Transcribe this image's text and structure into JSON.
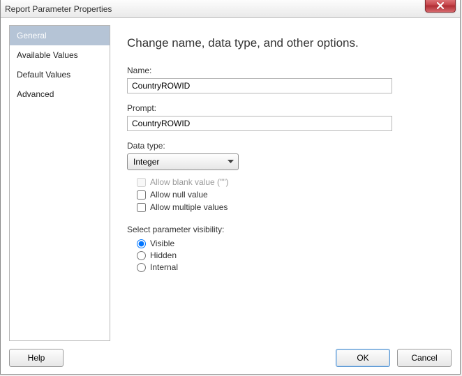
{
  "window": {
    "title": "Report Parameter Properties"
  },
  "sidebar": {
    "items": [
      {
        "label": "General",
        "selected": true
      },
      {
        "label": "Available Values",
        "selected": false
      },
      {
        "label": "Default Values",
        "selected": false
      },
      {
        "label": "Advanced",
        "selected": false
      }
    ]
  },
  "pane": {
    "heading": "Change name, data type, and other options.",
    "name_label": "Name:",
    "name_value": "CountryROWID",
    "prompt_label": "Prompt:",
    "prompt_value": "CountryROWID",
    "datatype_label": "Data type:",
    "datatype_value": "Integer",
    "allow_blank_label": "Allow blank value (\"\")",
    "allow_blank_checked": false,
    "allow_blank_enabled": false,
    "allow_null_label": "Allow null value",
    "allow_null_checked": false,
    "allow_multi_label": "Allow multiple values",
    "allow_multi_checked": false,
    "visibility_label": "Select parameter visibility:",
    "visibility_options": {
      "visible": "Visible",
      "hidden": "Hidden",
      "internal": "Internal"
    },
    "visibility_selected": "visible"
  },
  "buttons": {
    "help": "Help",
    "ok": "OK",
    "cancel": "Cancel"
  }
}
